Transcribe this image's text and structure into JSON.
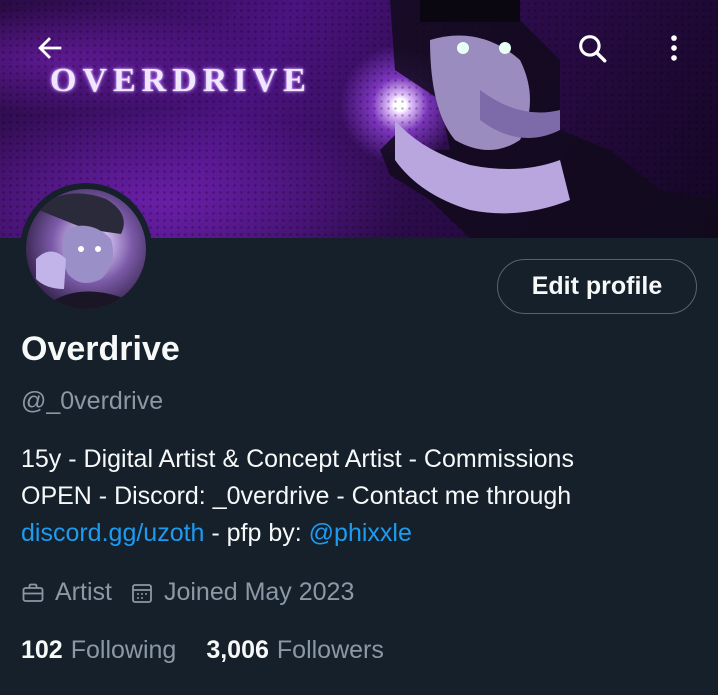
{
  "header": {
    "banner_title": "OVERDRIVE"
  },
  "profile": {
    "display_name": "Overdrive",
    "handle": "@_0verdrive",
    "edit_button": "Edit profile",
    "bio": {
      "line1": "15y - Digital Artist & Concept Artist - Commissions",
      "line2": "OPEN - Discord: _0verdrive - Contact me through",
      "link": "discord.gg/uzoth",
      "middle": " - pfp by: ",
      "mention": "@phixxle"
    },
    "meta": {
      "category": "Artist",
      "joined": "Joined May 2023"
    },
    "stats": {
      "following_count": "102",
      "following_label": "Following",
      "followers_count": "3,006",
      "followers_label": "Followers"
    }
  },
  "colors": {
    "background": "#15202b",
    "accent": "#1d9bf0",
    "muted_text": "#8b98a5",
    "primary_text": "#f7f9f9"
  },
  "icons": [
    "back-arrow-icon",
    "search-icon",
    "more-vertical-icon",
    "briefcase-icon",
    "calendar-icon"
  ]
}
